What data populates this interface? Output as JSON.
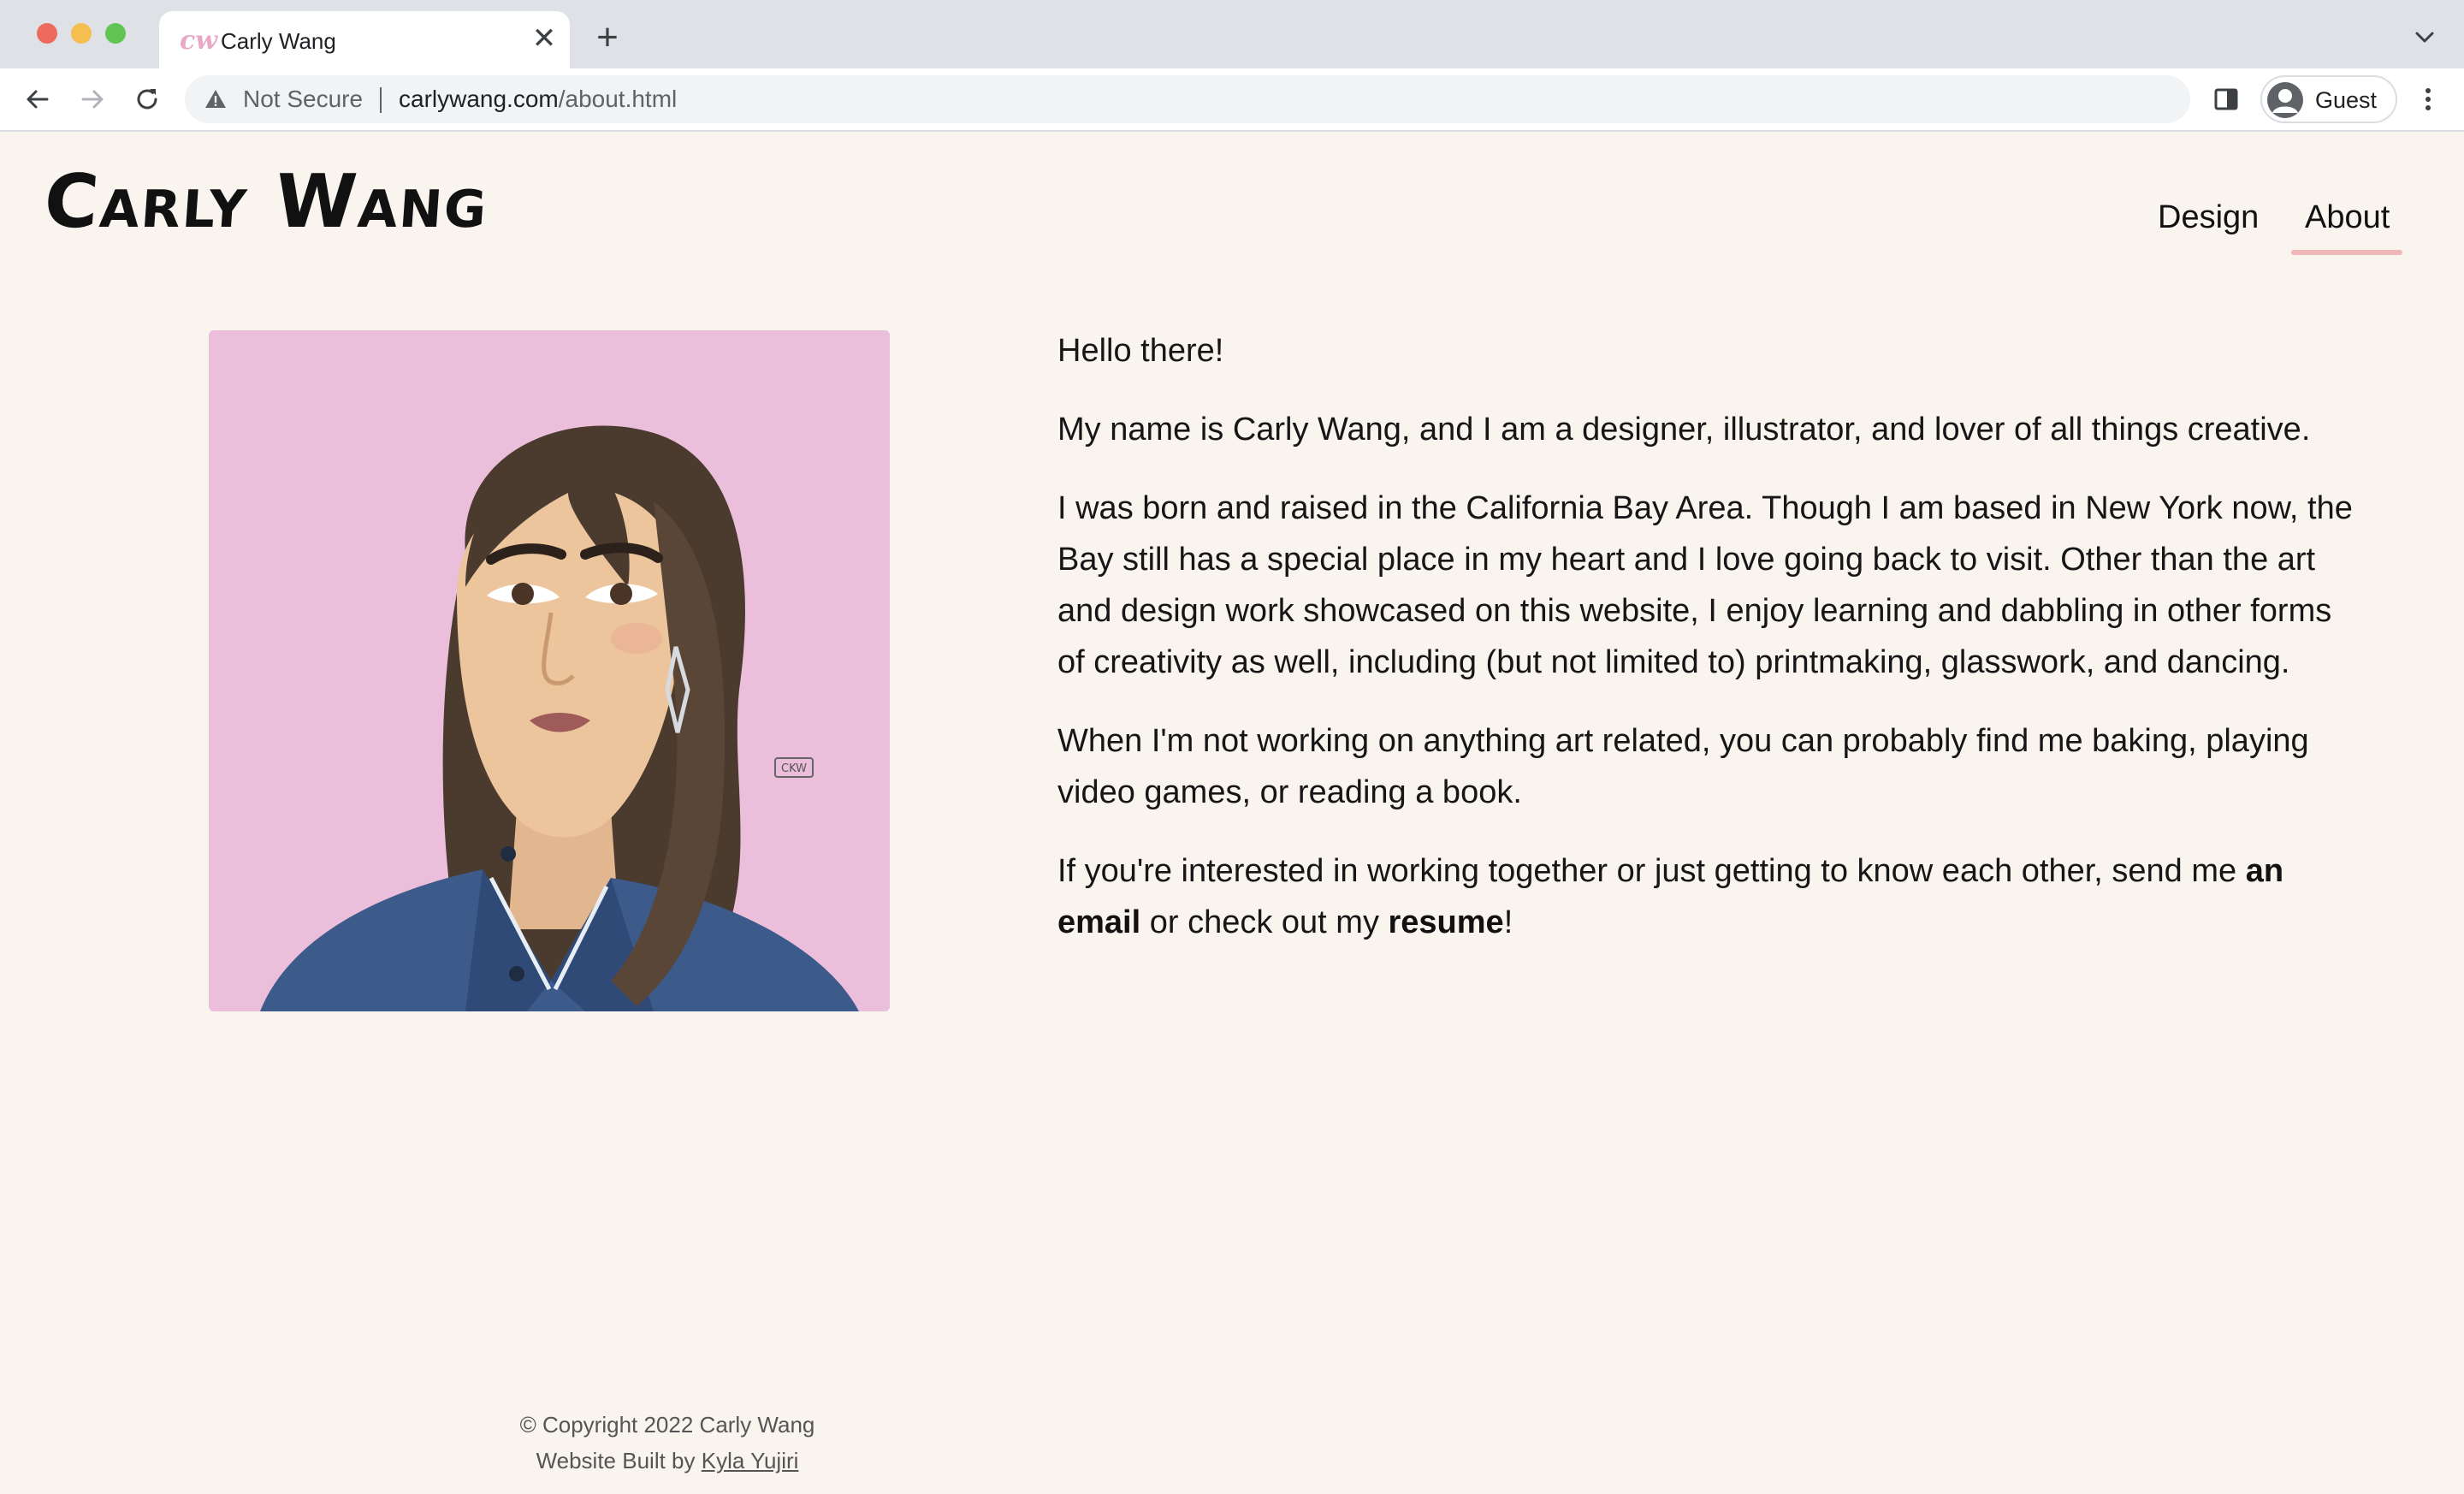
{
  "browser": {
    "tab_title": "Carly Wang",
    "tab_close": "✕",
    "new_tab": "+",
    "security_label": "Not Secure",
    "url_host": "carlywang.com",
    "url_path": "/about.html",
    "profile_name": "Guest",
    "icons": {
      "favicon": "cw-favicon-icon",
      "back": "arrow-left-icon",
      "forward": "arrow-right-icon",
      "reload": "reload-icon",
      "warning": "warning-triangle-icon",
      "side_panel": "side-panel-icon",
      "avatar": "person-avatar-icon",
      "menu": "kebab-menu-icon",
      "tab_search": "chevron-down-icon"
    }
  },
  "site": {
    "logo": "Carly Wang",
    "nav": [
      {
        "label": "Design"
      },
      {
        "label": "About",
        "active": true
      }
    ],
    "accent_color": "#f1b6b8",
    "background_color": "#f9f4ed"
  },
  "about": {
    "greeting": "Hello there!",
    "intro": "My name is Carly Wang, and I am a designer, illustrator, and lover of all things creative.",
    "background": "I was born and raised in the California Bay Area. Though I am based in New York now, the Bay still has a special place in my heart and I love going back to visit. Other than the art and design work showcased on this website, I enjoy learning and dabbling in other forms of creativity as well, including (but not limited to) printmaking, glasswork, and dancing.",
    "hobbies": "When I'm not working on anything art related, you can probably find me baking, playing video games, or reading a book.",
    "contact_pre": "If you're interested in working together or just getting to know each other, send me ",
    "contact_email_link": "an email",
    "contact_mid": " or check out my ",
    "contact_resume_link": "resume",
    "contact_post": "!",
    "portrait_signature": "CKW"
  },
  "footer": {
    "copyright": "© Copyright 2022 Carly Wang",
    "built_by_prefix": "Website Built by ",
    "built_by_name": "Kyla Yujiri"
  }
}
